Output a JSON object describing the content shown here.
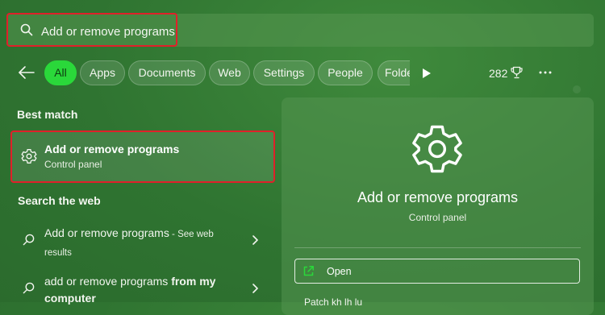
{
  "search": {
    "query": "Add or remove programs"
  },
  "filters": {
    "chips": [
      "All",
      "Apps",
      "Documents",
      "Web",
      "Settings",
      "People"
    ],
    "truncated_chip": "Folde",
    "active_chip": "All",
    "points": "282"
  },
  "left": {
    "best_match_heading": "Best match",
    "best_match": {
      "title": "Add or remove programs",
      "subtitle": "Control panel"
    },
    "search_web_heading": "Search the web",
    "web_results": [
      {
        "main": "Add or remove programs",
        "suffix": " - See web",
        "second_line": "results"
      },
      {
        "main": "add or remove programs ",
        "bold": "from my",
        "second_line": "computer"
      }
    ]
  },
  "panel": {
    "title": "Add or remove programs",
    "subtitle": "Control panel",
    "open_label": "Open",
    "next_item_partial": "Patch kh lh lu"
  },
  "colors": {
    "accent_green": "#2ad83a",
    "highlight_red": "#e0202a"
  },
  "icons": [
    "search-icon",
    "back-arrow-icon",
    "play-icon",
    "trophy-icon",
    "more-icon",
    "gear-icon",
    "chevron-right-icon",
    "open-external-icon"
  ]
}
